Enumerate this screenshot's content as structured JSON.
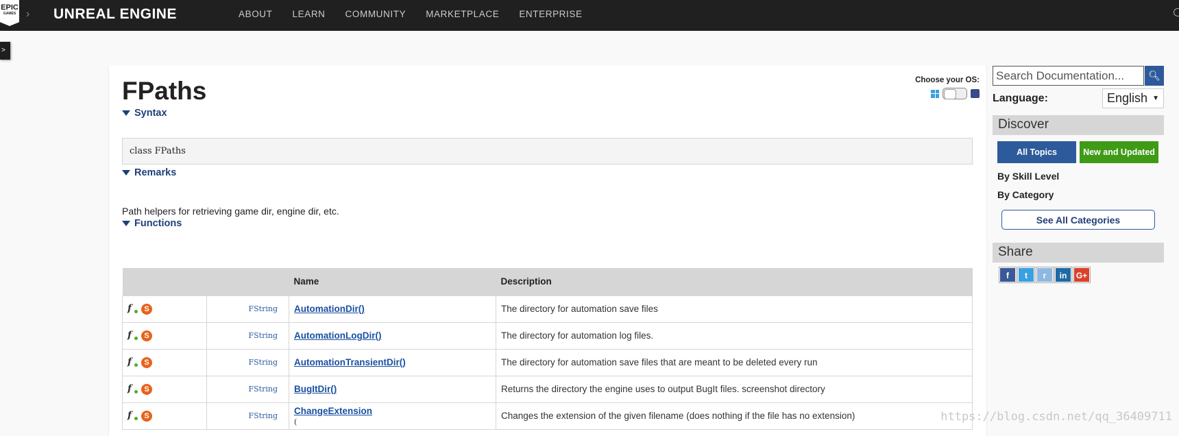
{
  "topbar": {
    "logo_line1": "EPIC",
    "logo_line2": "GAMES",
    "brand": "UNREAL ENGINE",
    "nav": [
      "ABOUT",
      "LEARN",
      "COMMUNITY",
      "MARKETPLACE",
      "ENTERPRISE"
    ]
  },
  "side_tab": ">",
  "page": {
    "title": "FPaths",
    "os_label": "Choose your OS:",
    "syntax_heading": "Syntax",
    "syntax_code": "class FPaths",
    "remarks_heading": "Remarks",
    "remarks_text": "Path helpers for retrieving game dir, engine dir, etc.",
    "functions_heading": "Functions"
  },
  "functions_table": {
    "headers": [
      "",
      "",
      "Name",
      "Description"
    ],
    "rows": [
      {
        "type": "FString",
        "name": "AutomationDir()",
        "description": "The directory for automation save files"
      },
      {
        "type": "FString",
        "name": "AutomationLogDir()",
        "description": "The directory for automation log files."
      },
      {
        "type": "FString",
        "name": "AutomationTransientDir()",
        "description": "The directory for automation save files that are meant to be deleted every run"
      },
      {
        "type": "FString",
        "name": "BugItDir()",
        "description": "Returns the directory the engine uses to output BugIt files. screenshot directory"
      },
      {
        "type": "FString",
        "name": "ChangeExtension",
        "paren": "(",
        "description": "Changes the extension of the given filename (does nothing if the file has no extension)"
      }
    ]
  },
  "sidebar": {
    "search_placeholder": "Search Documentation...",
    "language_label": "Language:",
    "language_value": "English",
    "discover_heading": "Discover",
    "all_topics": "All Topics",
    "new_and_updated": "New and Updated",
    "by_skill_level": "By Skill Level",
    "by_category": "By Category",
    "see_all_categories": "See All Categories",
    "share_heading": "Share",
    "share_icons": [
      {
        "label": "f",
        "icon": "facebook-icon",
        "color": "#3b5998"
      },
      {
        "label": "t",
        "icon": "twitter-icon",
        "color": "#3aa0e0"
      },
      {
        "label": "r",
        "icon": "reddit-icon",
        "color": "#8fb8e0"
      },
      {
        "label": "in",
        "icon": "linkedin-icon",
        "color": "#1f6aa5"
      },
      {
        "label": "G+",
        "icon": "googleplus-icon",
        "color": "#d9412d"
      }
    ]
  },
  "watermark": "https://blog.csdn.net/qq_36409711"
}
